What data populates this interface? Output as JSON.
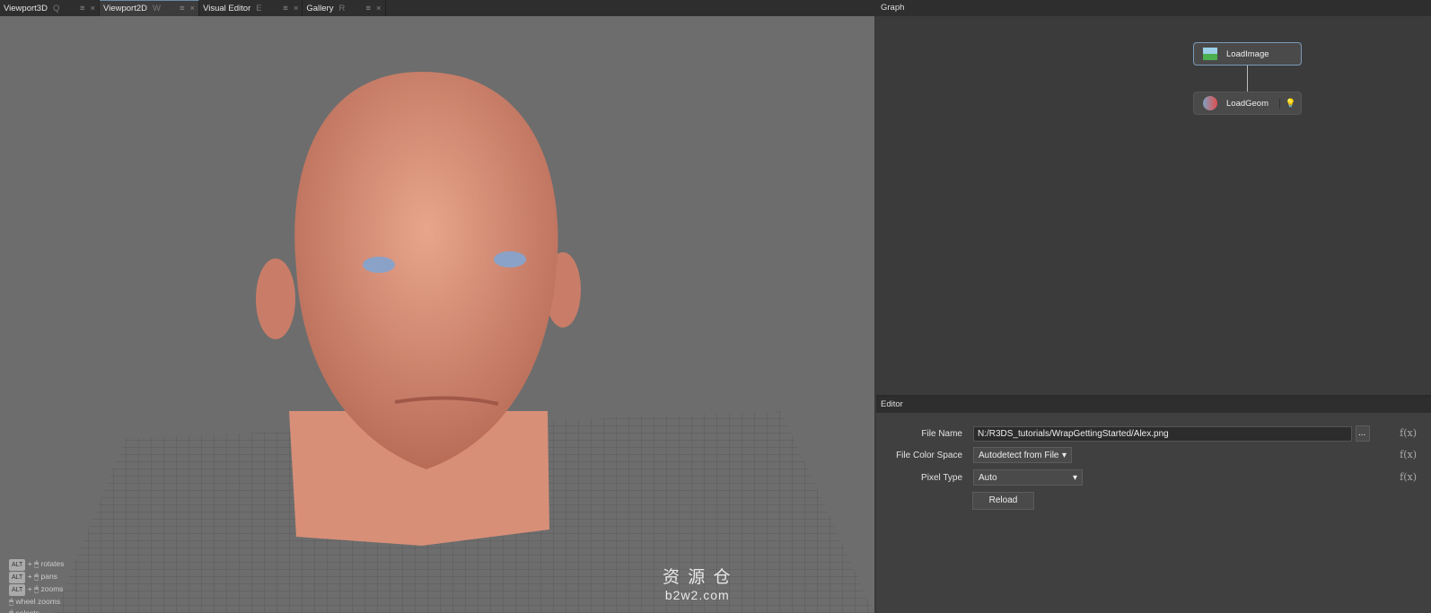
{
  "tabs": [
    {
      "label": "Viewport3D",
      "key": "Q"
    },
    {
      "label": "Viewport2D",
      "key": "W"
    },
    {
      "label": "Visual Editor",
      "key": "E"
    },
    {
      "label": "Gallery",
      "key": "R"
    }
  ],
  "graph": {
    "title": "Graph",
    "nodes": [
      {
        "label": "LoadImage"
      },
      {
        "label": "LoadGeom"
      }
    ]
  },
  "editor": {
    "title": "Editor",
    "file_name_label": "File Name",
    "file_name_value": "N:/R3DS_tutorials/WrapGettingStarted/Alex.png",
    "browse": "...",
    "color_space_label": "File Color Space",
    "color_space_value": "Autodetect from File",
    "pixel_type_label": "Pixel Type",
    "pixel_type_value": "Auto",
    "reload": "Reload",
    "fx": "f(x)"
  },
  "hints": {
    "alt": "ALT",
    "rotates": "rotates",
    "pans": "pans",
    "zooms": "zooms",
    "wheel": "wheel zooms",
    "selects": "selects"
  },
  "watermark": {
    "cn": "资 源 仓",
    "url": "b2w2.com"
  }
}
